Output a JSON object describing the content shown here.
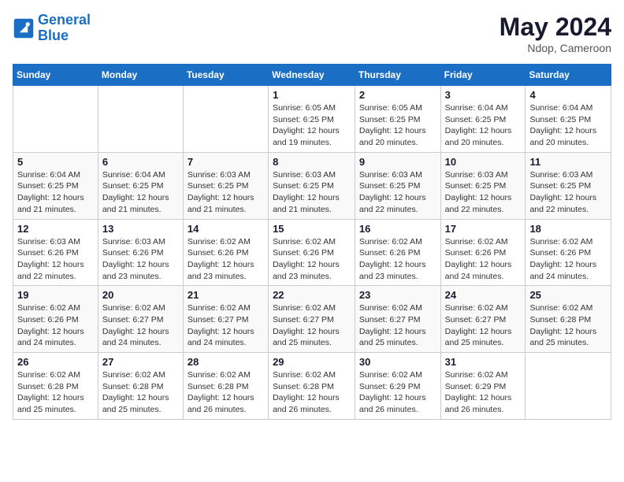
{
  "header": {
    "logo_line1": "General",
    "logo_line2": "Blue",
    "month": "May 2024",
    "location": "Ndop, Cameroon"
  },
  "days_of_week": [
    "Sunday",
    "Monday",
    "Tuesday",
    "Wednesday",
    "Thursday",
    "Friday",
    "Saturday"
  ],
  "weeks": [
    [
      {
        "day": "",
        "info": ""
      },
      {
        "day": "",
        "info": ""
      },
      {
        "day": "",
        "info": ""
      },
      {
        "day": "1",
        "info": "Sunrise: 6:05 AM\nSunset: 6:25 PM\nDaylight: 12 hours\nand 19 minutes."
      },
      {
        "day": "2",
        "info": "Sunrise: 6:05 AM\nSunset: 6:25 PM\nDaylight: 12 hours\nand 20 minutes."
      },
      {
        "day": "3",
        "info": "Sunrise: 6:04 AM\nSunset: 6:25 PM\nDaylight: 12 hours\nand 20 minutes."
      },
      {
        "day": "4",
        "info": "Sunrise: 6:04 AM\nSunset: 6:25 PM\nDaylight: 12 hours\nand 20 minutes."
      }
    ],
    [
      {
        "day": "5",
        "info": "Sunrise: 6:04 AM\nSunset: 6:25 PM\nDaylight: 12 hours\nand 21 minutes."
      },
      {
        "day": "6",
        "info": "Sunrise: 6:04 AM\nSunset: 6:25 PM\nDaylight: 12 hours\nand 21 minutes."
      },
      {
        "day": "7",
        "info": "Sunrise: 6:03 AM\nSunset: 6:25 PM\nDaylight: 12 hours\nand 21 minutes."
      },
      {
        "day": "8",
        "info": "Sunrise: 6:03 AM\nSunset: 6:25 PM\nDaylight: 12 hours\nand 21 minutes."
      },
      {
        "day": "9",
        "info": "Sunrise: 6:03 AM\nSunset: 6:25 PM\nDaylight: 12 hours\nand 22 minutes."
      },
      {
        "day": "10",
        "info": "Sunrise: 6:03 AM\nSunset: 6:25 PM\nDaylight: 12 hours\nand 22 minutes."
      },
      {
        "day": "11",
        "info": "Sunrise: 6:03 AM\nSunset: 6:25 PM\nDaylight: 12 hours\nand 22 minutes."
      }
    ],
    [
      {
        "day": "12",
        "info": "Sunrise: 6:03 AM\nSunset: 6:26 PM\nDaylight: 12 hours\nand 22 minutes."
      },
      {
        "day": "13",
        "info": "Sunrise: 6:03 AM\nSunset: 6:26 PM\nDaylight: 12 hours\nand 23 minutes."
      },
      {
        "day": "14",
        "info": "Sunrise: 6:02 AM\nSunset: 6:26 PM\nDaylight: 12 hours\nand 23 minutes."
      },
      {
        "day": "15",
        "info": "Sunrise: 6:02 AM\nSunset: 6:26 PM\nDaylight: 12 hours\nand 23 minutes."
      },
      {
        "day": "16",
        "info": "Sunrise: 6:02 AM\nSunset: 6:26 PM\nDaylight: 12 hours\nand 23 minutes."
      },
      {
        "day": "17",
        "info": "Sunrise: 6:02 AM\nSunset: 6:26 PM\nDaylight: 12 hours\nand 24 minutes."
      },
      {
        "day": "18",
        "info": "Sunrise: 6:02 AM\nSunset: 6:26 PM\nDaylight: 12 hours\nand 24 minutes."
      }
    ],
    [
      {
        "day": "19",
        "info": "Sunrise: 6:02 AM\nSunset: 6:26 PM\nDaylight: 12 hours\nand 24 minutes."
      },
      {
        "day": "20",
        "info": "Sunrise: 6:02 AM\nSunset: 6:27 PM\nDaylight: 12 hours\nand 24 minutes."
      },
      {
        "day": "21",
        "info": "Sunrise: 6:02 AM\nSunset: 6:27 PM\nDaylight: 12 hours\nand 24 minutes."
      },
      {
        "day": "22",
        "info": "Sunrise: 6:02 AM\nSunset: 6:27 PM\nDaylight: 12 hours\nand 25 minutes."
      },
      {
        "day": "23",
        "info": "Sunrise: 6:02 AM\nSunset: 6:27 PM\nDaylight: 12 hours\nand 25 minutes."
      },
      {
        "day": "24",
        "info": "Sunrise: 6:02 AM\nSunset: 6:27 PM\nDaylight: 12 hours\nand 25 minutes."
      },
      {
        "day": "25",
        "info": "Sunrise: 6:02 AM\nSunset: 6:28 PM\nDaylight: 12 hours\nand 25 minutes."
      }
    ],
    [
      {
        "day": "26",
        "info": "Sunrise: 6:02 AM\nSunset: 6:28 PM\nDaylight: 12 hours\nand 25 minutes."
      },
      {
        "day": "27",
        "info": "Sunrise: 6:02 AM\nSunset: 6:28 PM\nDaylight: 12 hours\nand 25 minutes."
      },
      {
        "day": "28",
        "info": "Sunrise: 6:02 AM\nSunset: 6:28 PM\nDaylight: 12 hours\nand 26 minutes."
      },
      {
        "day": "29",
        "info": "Sunrise: 6:02 AM\nSunset: 6:28 PM\nDaylight: 12 hours\nand 26 minutes."
      },
      {
        "day": "30",
        "info": "Sunrise: 6:02 AM\nSunset: 6:29 PM\nDaylight: 12 hours\nand 26 minutes."
      },
      {
        "day": "31",
        "info": "Sunrise: 6:02 AM\nSunset: 6:29 PM\nDaylight: 12 hours\nand 26 minutes."
      },
      {
        "day": "",
        "info": ""
      }
    ]
  ]
}
